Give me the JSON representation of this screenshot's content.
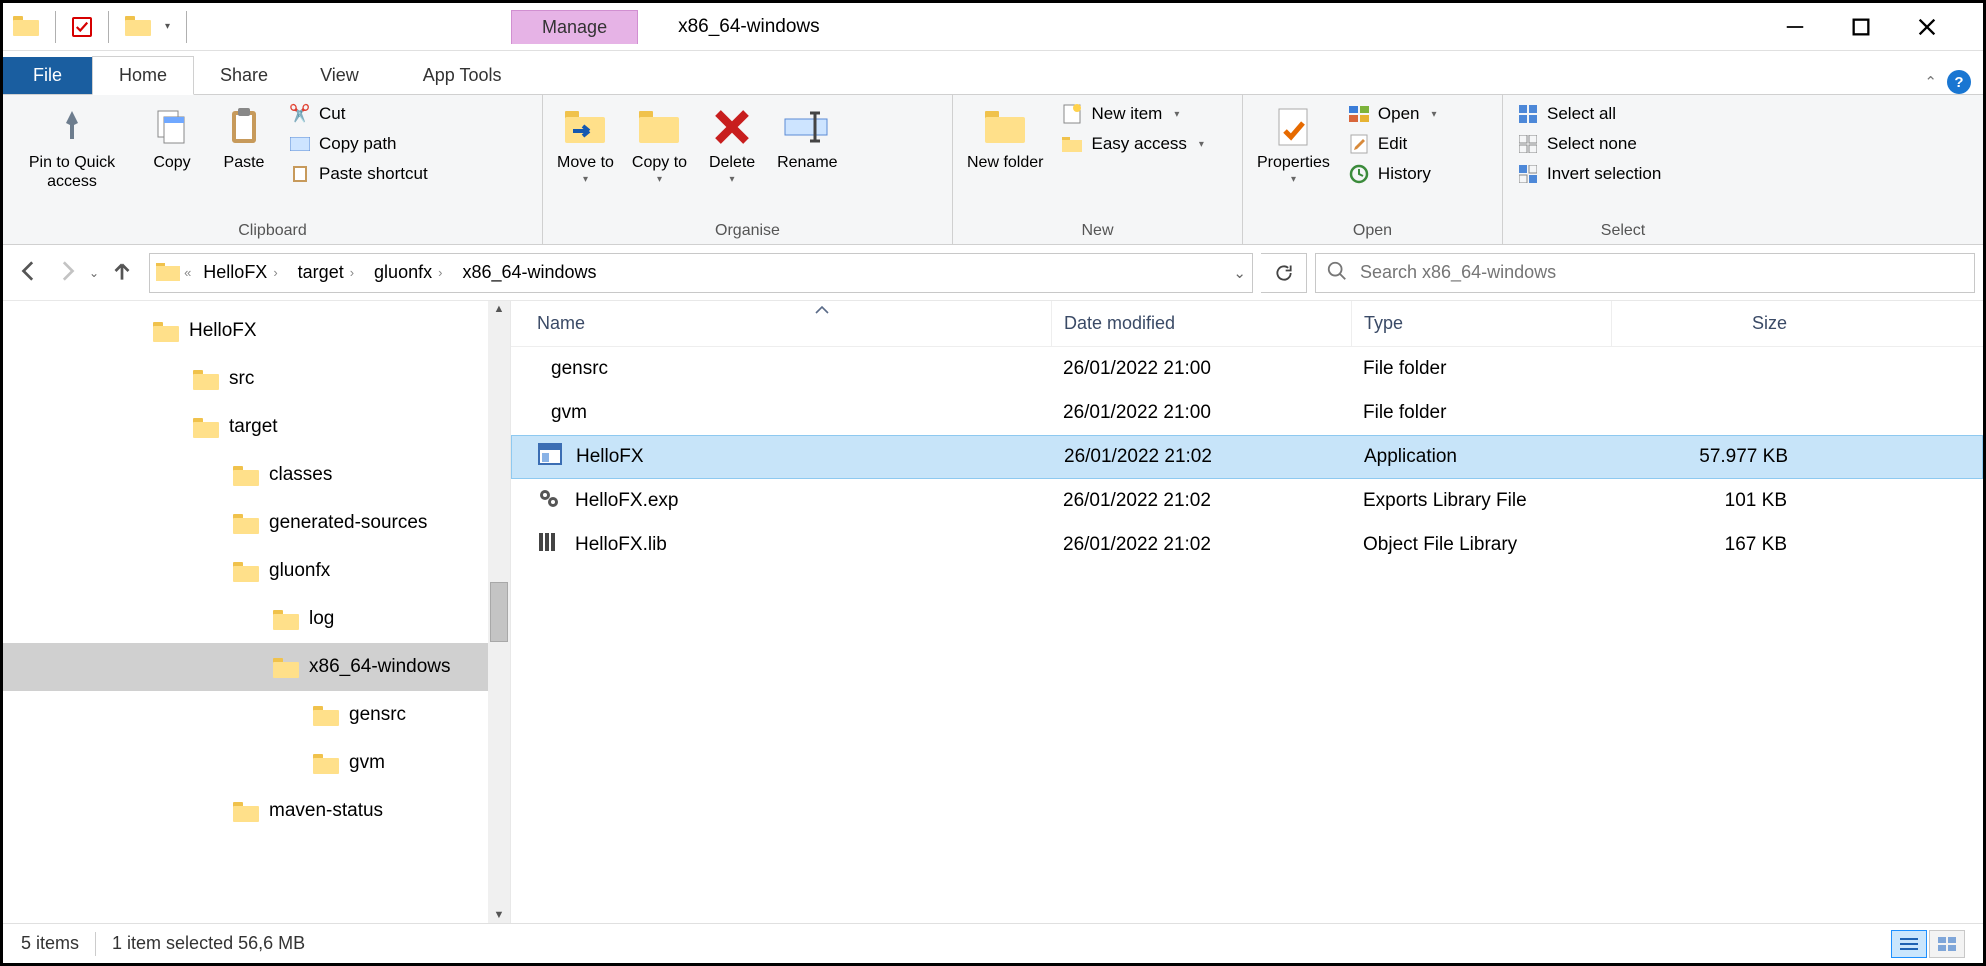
{
  "window": {
    "title": "x86_64-windows",
    "context_tab": "Manage",
    "context_sub": "App Tools"
  },
  "tabs": {
    "file": "File",
    "home": "Home",
    "share": "Share",
    "view": "View"
  },
  "ribbon": {
    "clipboard": {
      "pin": "Pin to Quick access",
      "copy": "Copy",
      "paste": "Paste",
      "cut": "Cut",
      "copy_path": "Copy path",
      "paste_shortcut": "Paste shortcut",
      "group": "Clipboard"
    },
    "organise": {
      "move": "Move to",
      "copy_to": "Copy to",
      "delete": "Delete",
      "rename": "Rename",
      "group": "Organise"
    },
    "new": {
      "new_folder": "New folder",
      "new_item": "New item",
      "easy_access": "Easy access",
      "group": "New"
    },
    "open": {
      "properties": "Properties",
      "open": "Open",
      "edit": "Edit",
      "history": "History",
      "group": "Open"
    },
    "select": {
      "all": "Select all",
      "none": "Select none",
      "invert": "Invert selection",
      "group": "Select"
    }
  },
  "breadcrumb": [
    "HelloFX",
    "target",
    "gluonfx",
    "x86_64-windows"
  ],
  "search": {
    "placeholder": "Search x86_64-windows"
  },
  "tree": [
    {
      "label": "HelloFX",
      "indent": 0
    },
    {
      "label": "src",
      "indent": 1
    },
    {
      "label": "target",
      "indent": 1
    },
    {
      "label": "classes",
      "indent": 2
    },
    {
      "label": "generated-sources",
      "indent": 2
    },
    {
      "label": "gluonfx",
      "indent": 2
    },
    {
      "label": "log",
      "indent": 3
    },
    {
      "label": "x86_64-windows",
      "indent": 3,
      "selected": true
    },
    {
      "label": "gensrc",
      "indent": 4
    },
    {
      "label": "gvm",
      "indent": 4
    },
    {
      "label": "maven-status",
      "indent": 2
    }
  ],
  "columns": {
    "name": "Name",
    "date": "Date modified",
    "type": "Type",
    "size": "Size"
  },
  "files": [
    {
      "icon": "folder",
      "name": "gensrc",
      "date": "26/01/2022 21:00",
      "type": "File folder",
      "size": ""
    },
    {
      "icon": "folder",
      "name": "gvm",
      "date": "26/01/2022 21:00",
      "type": "File folder",
      "size": ""
    },
    {
      "icon": "app",
      "name": "HelloFX",
      "date": "26/01/2022 21:02",
      "type": "Application",
      "size": "57.977 KB",
      "selected": true
    },
    {
      "icon": "gears",
      "name": "HelloFX.exp",
      "date": "26/01/2022 21:02",
      "type": "Exports Library File",
      "size": "101 KB"
    },
    {
      "icon": "lib",
      "name": "HelloFX.lib",
      "date": "26/01/2022 21:02",
      "type": "Object File Library",
      "size": "167 KB"
    }
  ],
  "status": {
    "count": "5 items",
    "selection": "1 item selected  56,6 MB"
  }
}
